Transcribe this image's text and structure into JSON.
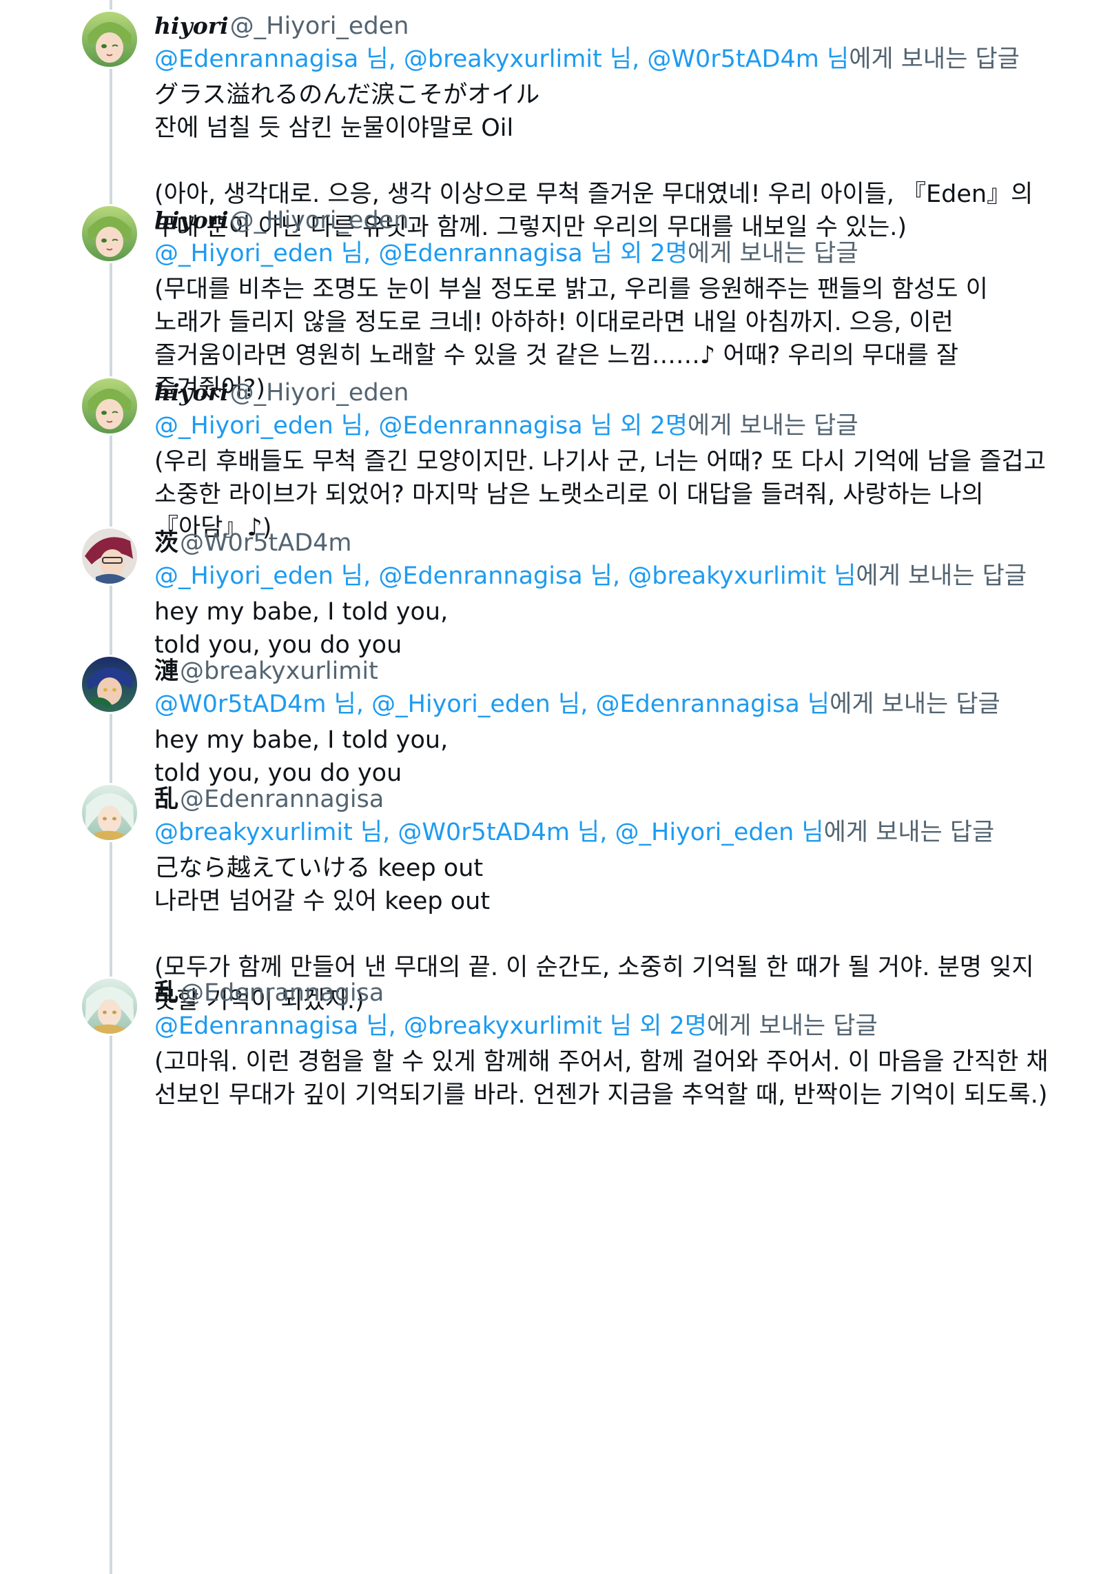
{
  "colors": {
    "link": "#1d9bf0",
    "muted": "#536471",
    "text": "#0f1419",
    "thread_line": "#cfd9de"
  },
  "tweets": [
    {
      "avatar": "hiyori-avatar",
      "display_name": "hiyori",
      "handle": "@_Hiyori_eden",
      "mentions": [
        "@Edenrannagisa 님",
        "@breakyxurlimit 님",
        "@W0r5tAD4m 님"
      ],
      "reply_suffix": "에게 보내는 답글",
      "lines": [
        "グラス溢れるのんだ涙こそがオイル",
        "잔에 넘칠 듯 삼킨 눈물이야말로 Oil",
        "",
        "(아아, 생각대로. 으응, 생각 이상으로 무척 즐거운 무대였네! 우리 아이들, 『Eden』의",
        "무대 뿐이 아닌 다른 유닛과 함께. 그렇지만 우리의 무대를 내보일 수 있는.)"
      ]
    },
    {
      "avatar": "hiyori-avatar",
      "display_name": "hiyori",
      "handle": "@_Hiyori_eden",
      "mentions": [
        "@_Hiyori_eden 님",
        "@Edenrannagisa 님 외 2명"
      ],
      "reply_suffix": "에게 보내는 답글",
      "lines": [
        "(무대를 비추는 조명도 눈이 부실 정도로 밝고, 우리를 응원해주는 팬들의 함성도 이",
        "노래가 들리지 않을 정도로 크네! 아하하! 이대로라면 내일 아침까지. 으응, 이런",
        "즐거움이라면 영원히 노래할 수 있을 것 같은 느낌……♪ 어때? 우리의 무대를 잘",
        "즐겨줬어?)"
      ]
    },
    {
      "avatar": "hiyori-avatar",
      "display_name": "hiyori",
      "handle": "@_Hiyori_eden",
      "mentions": [
        "@_Hiyori_eden 님",
        "@Edenrannagisa 님 외 2명"
      ],
      "reply_suffix": "에게 보내는 답글",
      "lines": [
        "(우리 후배들도 무척 즐긴 모양이지만. 나기사 군, 너는 어때? 또 다시 기억에 남을 즐겁고",
        "소중한 라이브가 되었어? 마지막 남은 노랫소리로 이 대답을 들려줘, 사랑하는 나의",
        "『아담』♪)"
      ]
    },
    {
      "avatar": "ibara-avatar",
      "display_name": "茨",
      "handle": "@W0r5tAD4m",
      "mentions": [
        "@_Hiyori_eden 님",
        "@Edenrannagisa 님",
        "@breakyxurlimit 님"
      ],
      "reply_suffix": "에게 보내는 답글",
      "lines": [
        "hey my babe, I told you,",
        "told you, you do you"
      ]
    },
    {
      "avatar": "jun-avatar",
      "display_name": "漣",
      "handle": "@breakyxurlimit",
      "mentions": [
        "@W0r5tAD4m 님",
        "@_Hiyori_eden 님",
        "@Edenrannagisa 님"
      ],
      "reply_suffix": "에게 보내는 답글",
      "lines": [
        "hey my babe, I told you,",
        "told you, you do you"
      ]
    },
    {
      "avatar": "nagisa-avatar",
      "display_name": "乱",
      "handle": "@Edenrannagisa",
      "mentions": [
        "@breakyxurlimit 님",
        "@W0r5tAD4m 님",
        "@_Hiyori_eden 님"
      ],
      "reply_suffix": "에게 보내는 답글",
      "lines": [
        "己なら越えていける  keep out",
        "나라면 넘어갈 수 있어  keep out",
        "",
        "(모두가 함께 만들어 낸 무대의 끝. 이 순간도, 소중히 기억될 한 때가 될 거야. 분명 잊지",
        "못할 기억이 되겠지.)"
      ]
    },
    {
      "avatar": "nagisa-avatar",
      "display_name": "乱",
      "handle": "@Edenrannagisa",
      "mentions": [
        "@Edenrannagisa 님",
        "@breakyxurlimit 님 외 2명"
      ],
      "reply_suffix": "에게 보내는 답글",
      "lines": [
        "(고마워. 이런 경험을 할 수 있게 함께해 주어서, 함께 걸어와 주어서. 이 마음을 간직한 채",
        "선보인 무대가 깊이 기억되기를 바라. 언젠가 지금을 추억할 때, 반짝이는 기억이 되도록.)"
      ]
    }
  ]
}
